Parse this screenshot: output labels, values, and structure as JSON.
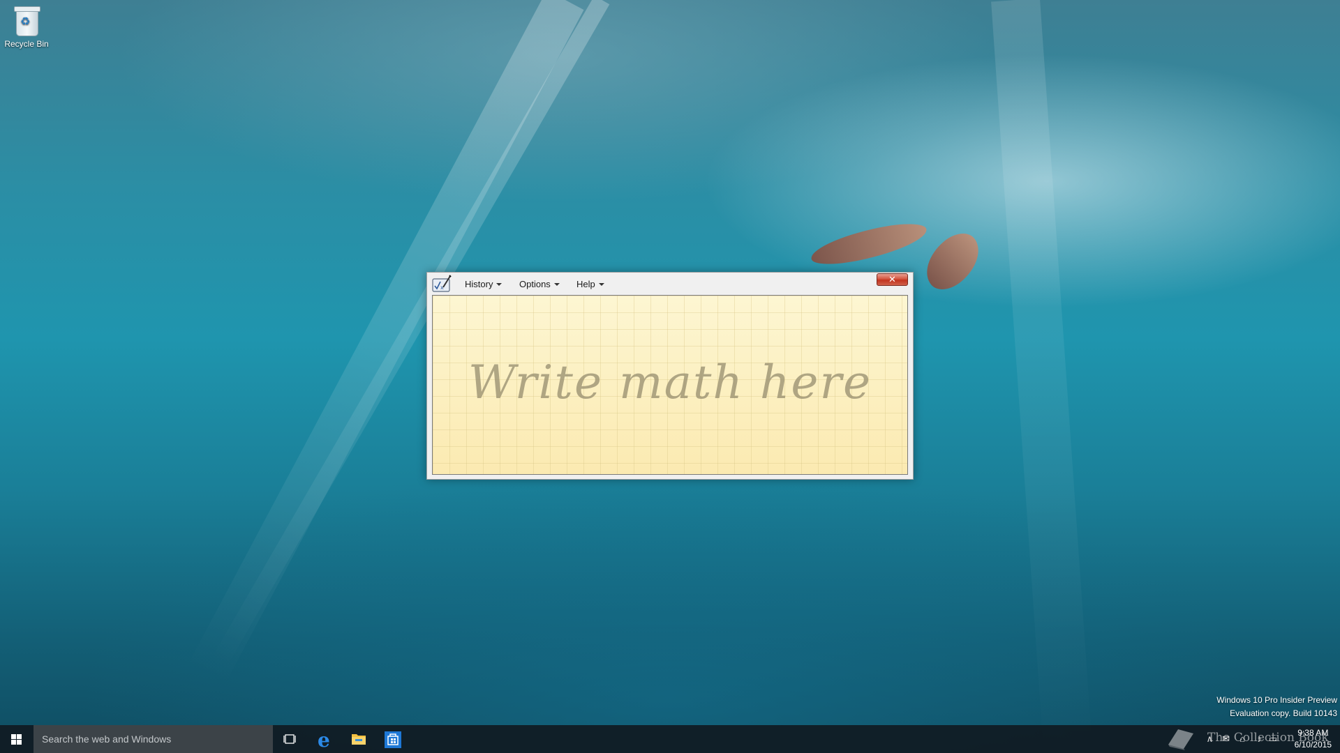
{
  "desktop": {
    "icons": [
      {
        "label": "Recycle Bin",
        "icon": "recycle-bin-icon"
      }
    ]
  },
  "math_panel": {
    "app_icon": "math-input-panel-icon",
    "menus": [
      {
        "label": "History",
        "icon": "dropdown-arrow"
      },
      {
        "label": "Options",
        "icon": "dropdown-arrow"
      },
      {
        "label": "Help",
        "icon": "dropdown-arrow"
      }
    ],
    "close_label": "✕",
    "writing_placeholder": "Write math here",
    "writing_area_color": "#fdf3c4"
  },
  "watermark": {
    "line1": "Windows 10 Pro Insider Preview",
    "line2": "Evaluation copy. Build 10143"
  },
  "taskbar": {
    "search_placeholder": "Search the web and Windows",
    "pinned": [
      {
        "name": "Task View",
        "icon": "task-view-icon"
      },
      {
        "name": "Microsoft Edge",
        "icon": "edge-icon"
      },
      {
        "name": "File Explorer",
        "icon": "file-explorer-icon"
      },
      {
        "name": "Store",
        "icon": "store-icon"
      }
    ],
    "clock": {
      "time": "9:38 AM",
      "date": "6/10/2015"
    },
    "overlay_brand": "The Collection Book"
  }
}
